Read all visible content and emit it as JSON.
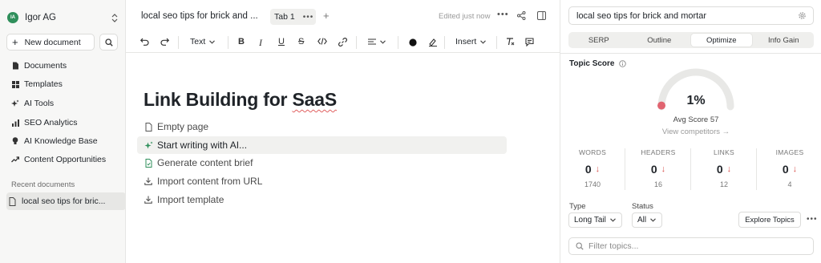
{
  "sidebar": {
    "workspace": {
      "initials": "IA",
      "name": "Igor AG"
    },
    "new_document": "New document",
    "nav": [
      {
        "label": "Documents",
        "icon": "document-icon"
      },
      {
        "label": "Templates",
        "icon": "grid-icon"
      },
      {
        "label": "AI Tools",
        "icon": "sparkle-icon"
      },
      {
        "label": "SEO Analytics",
        "icon": "bar-chart-icon"
      },
      {
        "label": "AI Knowledge Base",
        "icon": "bulb-icon"
      },
      {
        "label": "Content Opportunities",
        "icon": "trend-icon"
      }
    ],
    "recent_label": "Recent documents",
    "recent": [
      {
        "label": "local seo tips for bric..."
      }
    ]
  },
  "editor": {
    "doc_title": "local seo tips for brick and ...",
    "tab": "Tab 1",
    "edited": "Edited just now",
    "toolbar": {
      "text_style": "Text",
      "insert": "Insert"
    },
    "heading_before": "Link Building for ",
    "heading_flagged": "SaaS",
    "options": [
      {
        "label": "Empty page",
        "icon": "page-icon"
      },
      {
        "label": "Start writing with AI...",
        "icon": "sparkle-icon"
      },
      {
        "label": "Generate content brief",
        "icon": "brief-icon"
      },
      {
        "label": "Import content from URL",
        "icon": "download-icon"
      },
      {
        "label": "Import template",
        "icon": "download-icon"
      }
    ]
  },
  "panel": {
    "keyword": "local seo tips for brick and mortar",
    "tabs": [
      "SERP",
      "Outline",
      "Optimize",
      "Info Gain"
    ],
    "active_tab": "Optimize",
    "topic_score_label": "Topic Score",
    "score": "1%",
    "score_value": 1,
    "avg_score": "Avg Score 57",
    "view_competitors": "View competitors →",
    "metrics": [
      {
        "label": "WORDS",
        "value": "0",
        "target": "1740"
      },
      {
        "label": "HEADERS",
        "value": "0",
        "target": "16"
      },
      {
        "label": "LINKS",
        "value": "0",
        "target": "12"
      },
      {
        "label": "IMAGES",
        "value": "0",
        "target": "4"
      }
    ],
    "type_label": "Type",
    "type_value": "Long Tail",
    "status_label": "Status",
    "status_value": "All",
    "explore": "Explore Topics",
    "filter_placeholder": "Filter topics..."
  },
  "colors": {
    "score_low": "#e06470",
    "gauge_track": "#e8e8e6",
    "arrow_down": "#d9534f",
    "avatar": "#2f8f5b"
  }
}
